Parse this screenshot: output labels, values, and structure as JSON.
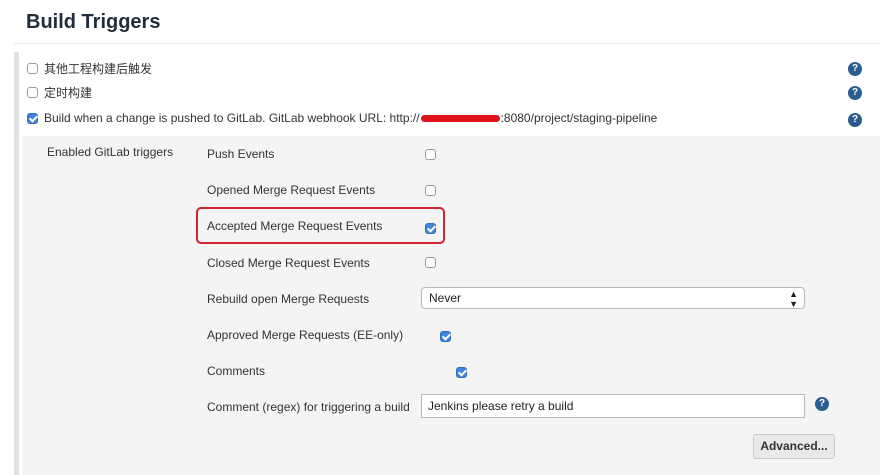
{
  "section": {
    "title": "Build Triggers"
  },
  "triggers": [
    {
      "label": "其他工程构建后触发",
      "checked": false
    },
    {
      "label": "定时构建",
      "checked": false
    },
    {
      "label_prefix": "Build when a change is pushed to GitLab. GitLab webhook URL: http://",
      "label_suffix": ":8080/project/staging-pipeline",
      "checked": true
    }
  ],
  "gitlab": {
    "title": "Enabled GitLab triggers",
    "options": [
      {
        "label": "Push Events",
        "checked": false
      },
      {
        "label": "Opened Merge Request Events",
        "checked": false
      },
      {
        "label": "Accepted Merge Request Events",
        "checked": true
      },
      {
        "label": "Closed Merge Request Events",
        "checked": false
      },
      {
        "label": "Rebuild open Merge Requests",
        "value": "Never"
      },
      {
        "label": "Approved Merge Requests (EE-only)",
        "checked": true
      },
      {
        "label": "Comments",
        "checked": true
      },
      {
        "label": "Comment (regex) for triggering a build",
        "value": "Jenkins please retry a build"
      }
    ],
    "advanced_label": "Advanced..."
  },
  "help_icon_glyph": "?",
  "colors": {
    "checkbox_checked": "#3f84d8",
    "highlight": "#d1242f",
    "redaction": "#e0121c",
    "help_icon": "#2c5d8f"
  }
}
